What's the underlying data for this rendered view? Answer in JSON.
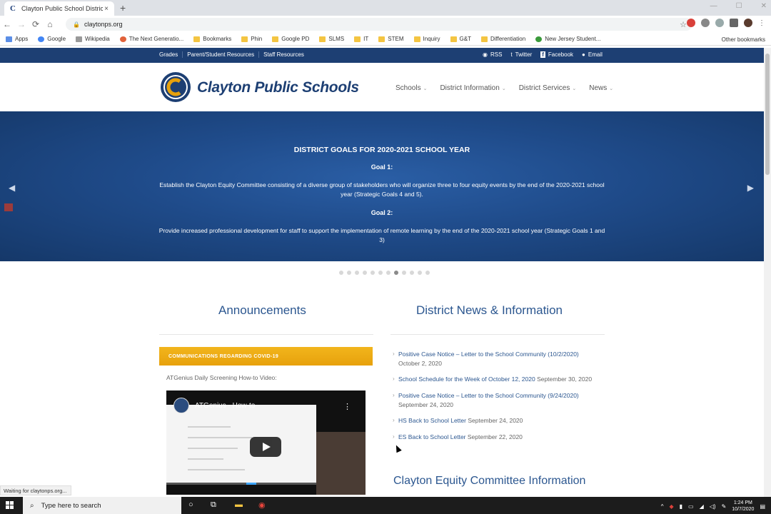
{
  "browser": {
    "tab_title": "Clayton Public School District",
    "tab_close": "×",
    "new_tab": "+",
    "url": "claytonps.org",
    "status": "Waiting for claytonps.org...",
    "bookmarks": [
      "Apps",
      "Google",
      "Wikipedia",
      "The Next Generatio...",
      "Bookmarks",
      "Phin",
      "Google PD",
      "SLMS",
      "IT",
      "STEM",
      "Inquiry",
      "G&T",
      "Differentiation",
      "New Jersey Student..."
    ],
    "other_bookmarks": "Other bookmarks"
  },
  "topbar": {
    "links": [
      "Grades",
      "Parent/Student Resources",
      "Staff Resources"
    ],
    "social": [
      "RSS",
      "Twitter",
      "Facebook",
      "Email"
    ]
  },
  "header": {
    "brand": "Clayton Public Schools",
    "nav": [
      "Schools",
      "District Information",
      "District Services",
      "News"
    ]
  },
  "hero": {
    "title": "DISTRICT GOALS FOR 2020-2021 SCHOOL YEAR",
    "goal1_label": "Goal 1:",
    "goal1_text": "Establish the Clayton Equity Committee consisting of a diverse group of stakeholders who will organize three to four equity events by the end of the 2020-2021 school year (Strategic Goals 4 and 5).",
    "goal2_label": "Goal 2:",
    "goal2_text": "Provide increased professional development for staff to support the implementation of remote learning by the end of the 2020-2021 school year (Strategic Goals 1 and 3)"
  },
  "announcements": {
    "title": "Announcements",
    "covid_bar": "COMMUNICATIONS REGARDING COVID-19",
    "video_label": "ATGenius Daily Screening How-to Video:",
    "video_title": "ATGenius - How-to"
  },
  "news": {
    "title": "District News & Information",
    "items": [
      {
        "link": "Positive Case Notice – Letter to the School Community (10/2/2020)",
        "date": "October 2, 2020"
      },
      {
        "link": "School Schedule for the Week of October 12, 2020",
        "date": "September 30, 2020"
      },
      {
        "link": "Positive Case Notice – Letter to the School Community (9/24/2020)",
        "date": "September 24, 2020"
      },
      {
        "link": "HS Back to School Letter",
        "date": "September 24, 2020"
      },
      {
        "link": "ES Back to School Letter",
        "date": "September 22, 2020"
      }
    ]
  },
  "equity": {
    "title": "Clayton Equity Committee Information"
  },
  "taskbar": {
    "search_placeholder": "Type here to search",
    "time": "1:24 PM",
    "date": "10/7/2020"
  },
  "colors": {
    "brand_blue": "#1d3f73",
    "accent_gold": "#e7a10c",
    "link_blue": "#2c5790"
  }
}
